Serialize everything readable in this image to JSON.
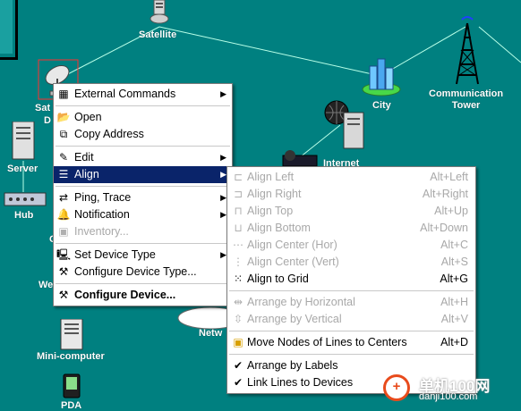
{
  "network": {
    "labels": {
      "satellite": "Satellite",
      "city": "City",
      "communication_tower_line1": "Communication",
      "communication_tower_line2": "Tower",
      "server": "Server",
      "hub": "Hub",
      "internet": "Internet",
      "mini_computer": "Mini-computer",
      "pda": "PDA",
      "sat_dish_partial_1": "Sat",
      "sat_dish_partial_2": "D",
      "partial_w": "We",
      "partial_o": "O",
      "partial_netw": "Netw"
    },
    "colors": {
      "background": "#008080",
      "link_line": "#b8ffe8"
    }
  },
  "context_menu": {
    "items": [
      {
        "label": "External Commands",
        "icon": "external-commands-icon",
        "submenu": true
      },
      {
        "separator": true
      },
      {
        "label": "Open",
        "icon": "folder-open-icon"
      },
      {
        "label": "Copy Address",
        "icon": "copy-icon"
      },
      {
        "separator": true
      },
      {
        "label": "Edit",
        "icon": "edit-icon",
        "submenu": true
      },
      {
        "label": "Align",
        "icon": "align-icon",
        "submenu": true,
        "active": true
      },
      {
        "separator": true
      },
      {
        "label": "Ping, Trace",
        "icon": "ping-icon",
        "submenu": true
      },
      {
        "label": "Notification",
        "icon": "bell-icon",
        "submenu": true
      },
      {
        "label": "Inventory...",
        "icon": "inventory-icon",
        "disabled": true
      },
      {
        "separator": true
      },
      {
        "label": "Set Device Type",
        "icon": "computer-icon",
        "submenu": true
      },
      {
        "label": "Configure Device Type...",
        "icon": "tools-icon"
      },
      {
        "separator": true
      },
      {
        "label": "Configure Device...",
        "icon": "wrench-icon",
        "bold": true
      }
    ]
  },
  "align_submenu": {
    "items": [
      {
        "label": "Align Left",
        "shortcut": "Alt+Left",
        "disabled": true,
        "icon": "align-left-icon"
      },
      {
        "label": "Align Right",
        "shortcut": "Alt+Right",
        "disabled": true,
        "icon": "align-right-icon"
      },
      {
        "label": "Align Top",
        "shortcut": "Alt+Up",
        "disabled": true,
        "icon": "align-top-icon"
      },
      {
        "label": "Align Bottom",
        "shortcut": "Alt+Down",
        "disabled": true,
        "icon": "align-bottom-icon"
      },
      {
        "label": "Align Center (Hor)",
        "shortcut": "Alt+C",
        "disabled": true,
        "icon": "align-center-hor-icon"
      },
      {
        "label": "Align Center (Vert)",
        "shortcut": "Alt+S",
        "disabled": true,
        "icon": "align-center-vert-icon"
      },
      {
        "label": "Align to Grid",
        "shortcut": "Alt+G",
        "disabled": false,
        "icon": "grid-icon"
      },
      {
        "separator": true
      },
      {
        "label": "Arrange by Horizontal",
        "shortcut": "Alt+H",
        "disabled": true,
        "icon": "arrange-horizontal-icon"
      },
      {
        "label": "Arrange by Vertical",
        "shortcut": "Alt+V",
        "disabled": true,
        "icon": "arrange-vertical-icon"
      },
      {
        "separator": true
      },
      {
        "label": "Move Nodes of Lines to Centers",
        "shortcut": "Alt+D",
        "disabled": false,
        "icon": "move-nodes-icon"
      },
      {
        "separator": true
      },
      {
        "label": "Arrange by Labels",
        "shortcut": "",
        "disabled": false,
        "checked": true,
        "icon": "check-icon"
      },
      {
        "label": "Link Lines to Devices",
        "shortcut": "",
        "disabled": false,
        "checked": true,
        "icon": "check-icon"
      }
    ]
  },
  "watermark": {
    "text": "单机100网",
    "domain": "danji100.com"
  }
}
